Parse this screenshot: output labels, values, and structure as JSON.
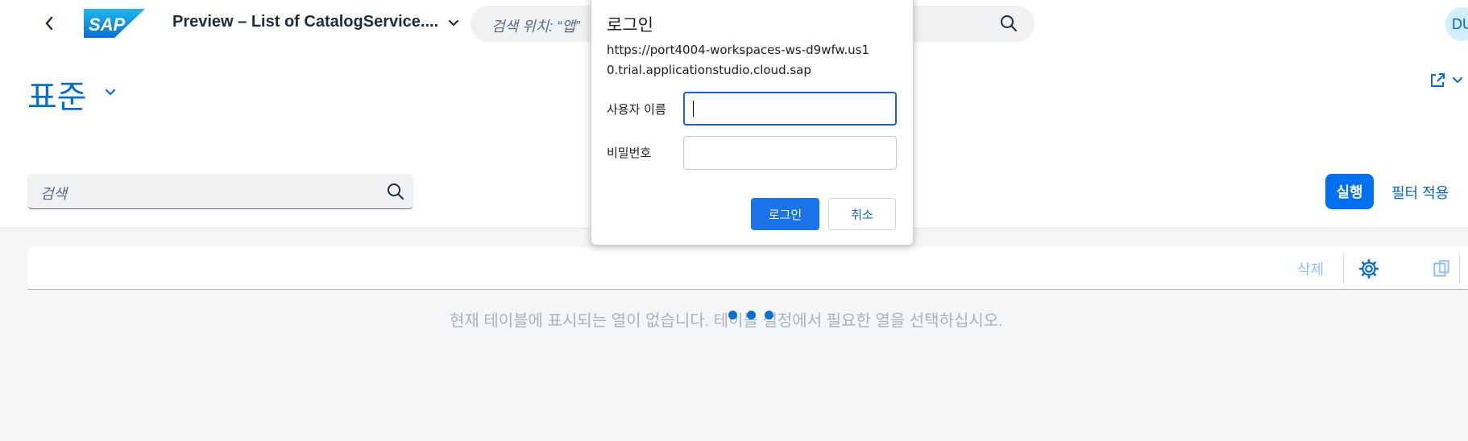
{
  "shell": {
    "logo_text": "SAP",
    "app_title": "Preview – List of CatalogService....",
    "search_placeholder": "검색 위치: “앱”",
    "avatar_initials": "DU"
  },
  "header": {
    "variant_title": "표준"
  },
  "filter_bar": {
    "search_placeholder": "검색",
    "go_label": "실행",
    "adapt_filters_label": "필터 적용"
  },
  "table": {
    "delete_label": "삭제",
    "no_data_text": "현재 테이블에 표시되는 열이 없습니다. 테이블 설정에서 필요한 열을 선택하십시오."
  },
  "login_dialog": {
    "title": "로그인",
    "url": "https://port4004-workspaces-ws-d9wfw.us10.trial.applicationstudio.cloud.sap",
    "username_label": "사용자 이름",
    "username_value": "",
    "password_label": "비밀번호",
    "password_value": "",
    "login_button": "로그인",
    "cancel_button": "취소"
  },
  "colors": {
    "accent": "#0070f2",
    "link": "#0064d9",
    "shell_bg": "#ffffff",
    "page_bg": "#f5f6f7"
  },
  "icons": [
    "back-icon",
    "sap-logo",
    "chevron-down-icon",
    "search-icon",
    "share-icon",
    "settings-icon",
    "export-icon"
  ]
}
